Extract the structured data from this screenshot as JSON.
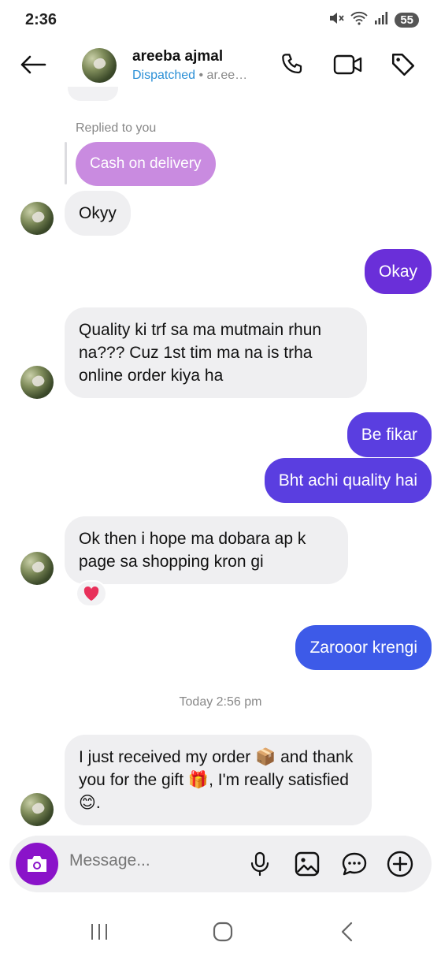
{
  "status_bar": {
    "time": "2:36",
    "battery": "55"
  },
  "header": {
    "name": "areeba ajmal",
    "status": "Dispatched",
    "separator": " • ",
    "handle": "ar.ee…"
  },
  "chat": {
    "reply_label": "Replied to you",
    "replied_message": "Cash on delivery",
    "messages": [
      {
        "side": "in",
        "text": "Okyy"
      },
      {
        "side": "out",
        "text": "Okay"
      },
      {
        "side": "in",
        "text": "Quality ki trf sa ma mutmain rhun na??? Cuz 1st tim ma na is trha online order kiya ha"
      },
      {
        "side": "out",
        "text": "Be fikar"
      },
      {
        "side": "out",
        "text": "Bht achi quality hai"
      },
      {
        "side": "in",
        "text": "Ok  then i hope ma dobara ap k page sa shopping kron gi",
        "reaction": "❤️"
      },
      {
        "side": "out",
        "text": "Zarooor krengi"
      },
      {
        "side": "in",
        "text_parts": [
          "I just received my order ",
          "📦",
          " and thank you for the gift ",
          "🎁",
          ", I'm really satisfied ",
          "😊",
          "."
        ]
      }
    ],
    "timestamp": "Today 2:56 pm"
  },
  "composer": {
    "placeholder": "Message..."
  },
  "colors": {
    "incoming": "#efeff1",
    "outgoing_purple": "#6a2fd9",
    "outgoing_indigo": "#5a3ee0",
    "outgoing_blue": "#3d5ae8",
    "reply_bubble": "#c98be0",
    "camera_button": "#8a13c9",
    "dispatched": "#2a8fd6"
  },
  "icons": [
    "back-arrow-icon",
    "phone-icon",
    "video-icon",
    "tag-icon",
    "camera-icon",
    "microphone-icon",
    "gallery-icon",
    "sticker-icon",
    "plus-icon",
    "recent-apps-icon",
    "home-icon",
    "nav-back-icon",
    "mute-icon",
    "wifi-icon",
    "signal-icon"
  ]
}
